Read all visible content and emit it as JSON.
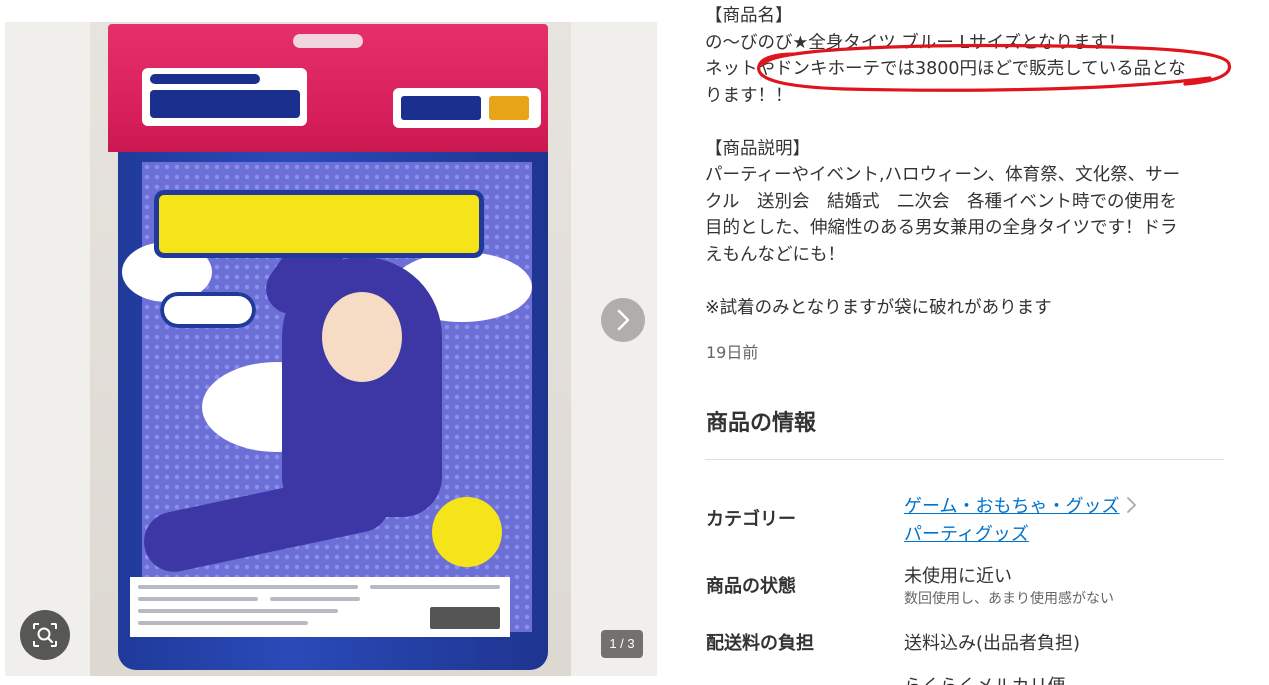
{
  "gallery": {
    "counter": "1 / 3",
    "next_icon": "chevron-right-icon",
    "zoom_icon": "image-search-icon"
  },
  "description": {
    "lines": [
      "【商品名】",
      "の〜びのび★全身タイツ ブルー Lサイズとなります！",
      "ネットやドンキホーテでは3800円ほどで販売している品とな",
      "ります！！",
      "",
      "【商品説明】",
      "パーティーやイベント,ハロウィーン、体育祭、文化祭、サー",
      "クル　送別会　結婚式　二次会　各種イベント時での使用を",
      "目的とした、伸縮性のある男女兼用の全身タイツです！ドラ",
      "えもんなどにも！",
      "",
      "※試着のみとなりますが袋に破れがあります"
    ],
    "annotation_color": "#e0141e"
  },
  "posted": "19日前",
  "info": {
    "title": "商品の情報",
    "category_label": "カテゴリー",
    "category_links": [
      "ゲーム・おもちゃ・グッズ",
      "パーティグッズ"
    ],
    "condition_label": "商品の状態",
    "condition_value": "未使用に近い",
    "condition_sub": "数回使用し、あまり使用感がない",
    "shipping_label": "配送料の負担",
    "shipping_value": "送料込み(出品者負担)",
    "next_value_partial": "らくらくメルカリ便"
  },
  "colors": {
    "link": "#0073cc",
    "text": "#333333",
    "muted": "#666666"
  }
}
